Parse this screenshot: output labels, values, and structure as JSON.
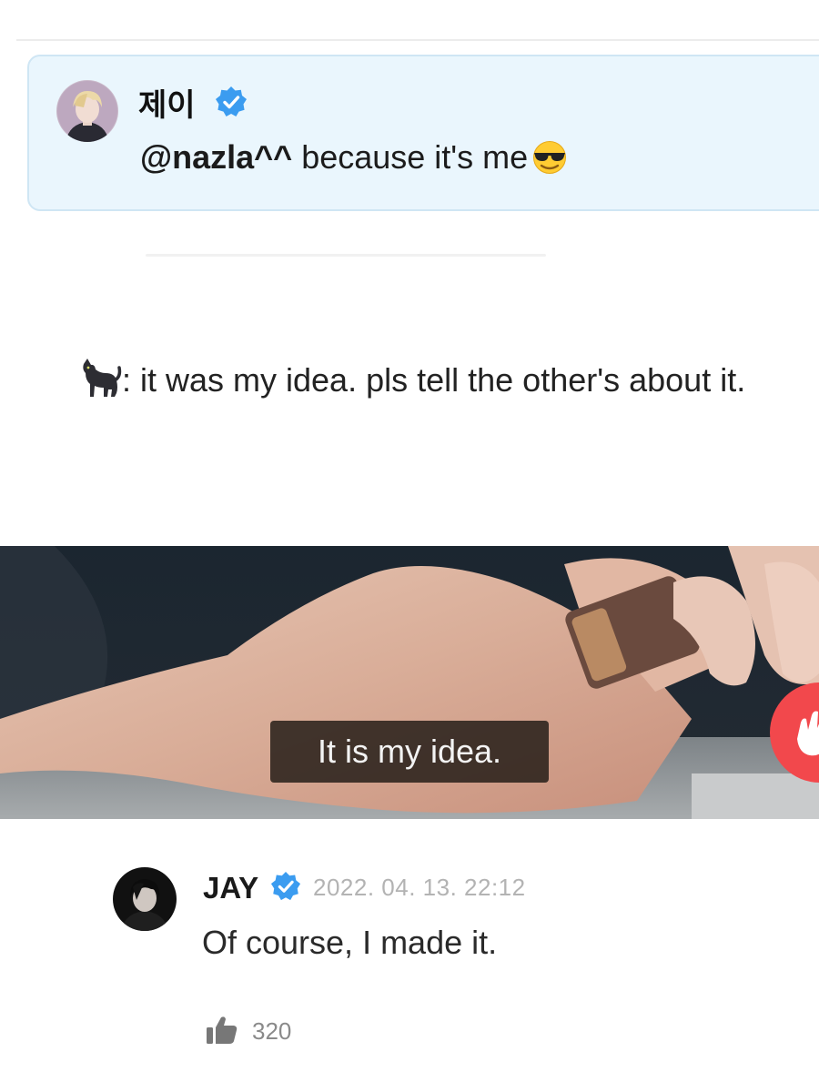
{
  "reply": {
    "display_name": "제이",
    "mention": "@nazla^^",
    "message": " because it's me"
  },
  "caption": {
    "text": ": it was my idea. pls tell the other's about it."
  },
  "video": {
    "subtitle": "It is my idea."
  },
  "comment": {
    "author": "JAY",
    "date": "2022. 04. 13. 22:12",
    "text": "Of course, I made it.",
    "like_count": "320"
  },
  "icons": {
    "verified": "verified-badge-icon",
    "emoji_sunglasses": "smiling-face-with-sunglasses",
    "emoji_cat": "black-cat",
    "like": "thumbs-up-icon",
    "reaction": "hand-reaction-icon"
  },
  "colors": {
    "verified_blue": "#3b9cf0",
    "reply_card_bg": "#eaf6fd",
    "reaction_red": "#f2484c"
  }
}
